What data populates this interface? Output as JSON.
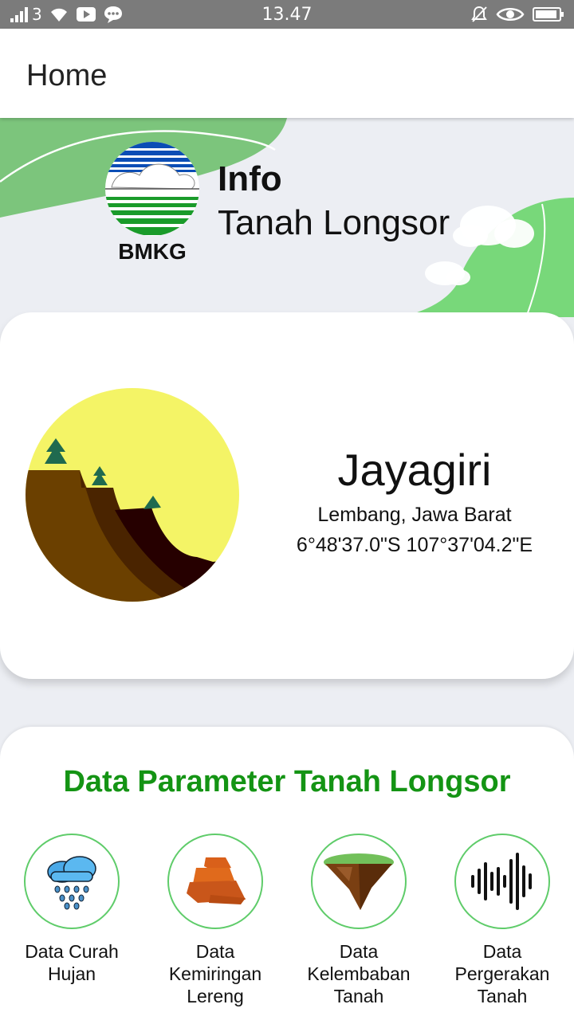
{
  "status_bar": {
    "carrier": "3",
    "time": "13.47"
  },
  "app_bar": {
    "title": "Home"
  },
  "header": {
    "logo_text": "BMKG",
    "info_label": "Info",
    "info_subtitle": "Tanah Longsor"
  },
  "location": {
    "name": "Jayagiri",
    "region": "Lembang, Jawa Barat",
    "coordinates": "6°48'37.0\"S 107°37'04.2\"E"
  },
  "parameters": {
    "title": "Data Parameter Tanah Longsor",
    "items": [
      {
        "label": "Data Curah Hujan",
        "icon": "rain-cloud-icon"
      },
      {
        "label": "Data Kemiringan Lereng",
        "icon": "slope-rock-icon"
      },
      {
        "label": "Data Kelembaban Tanah",
        "icon": "floating-soil-icon"
      },
      {
        "label": "Data Pergerakan Tanah",
        "icon": "sound-wave-icon"
      }
    ]
  },
  "colors": {
    "accent_green": "#149414",
    "circle_border": "#5fcc6a",
    "status_bar": "#7b7b7b"
  }
}
